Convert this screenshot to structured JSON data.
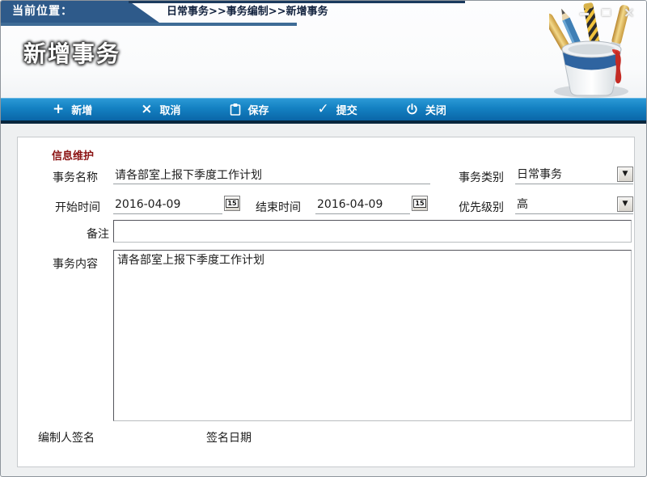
{
  "topbar": {
    "location_label": "当前位置：",
    "breadcrumb": "日常事务>>事务编制>>新增事务"
  },
  "window_controls": {
    "close_glyph": "×"
  },
  "header": {
    "title": "新增事务"
  },
  "toolbar": {
    "buttons": [
      {
        "label": "新增",
        "glyph": "+"
      },
      {
        "label": "取消",
        "glyph": "×"
      },
      {
        "label": "保存",
        "glyph": ""
      },
      {
        "label": "提交",
        "glyph": "✓"
      },
      {
        "label": "关闭",
        "glyph": ""
      }
    ]
  },
  "form": {
    "section_title": "信息维护",
    "task_name": {
      "label": "事务名称",
      "value": "请各部室上报下季度工作计划"
    },
    "category": {
      "label": "事务类别",
      "value": "日常事务"
    },
    "start_time": {
      "label": "开始时间",
      "value": "2016-04-09"
    },
    "end_time": {
      "label": "结束时间",
      "value": "2016-04-09"
    },
    "priority": {
      "label": "优先级别",
      "value": "高"
    },
    "remarks": {
      "label": "备注",
      "value": ""
    },
    "content": {
      "label": "事务内容",
      "value": "请各部室上报下季度工作计划"
    },
    "signer_label": "编制人签名",
    "sign_date_label": "签名日期"
  },
  "icons": {
    "calendar_day": "15",
    "dropdown_arrow": "▼"
  },
  "colors": {
    "topbar_blue": "#2e5a8a",
    "topbar_underline": "#3e6b96",
    "toolbar_blue_top": "#2d9bd8",
    "toolbar_blue_bottom": "#0a66a8",
    "section_title_red": "#8b1212"
  }
}
